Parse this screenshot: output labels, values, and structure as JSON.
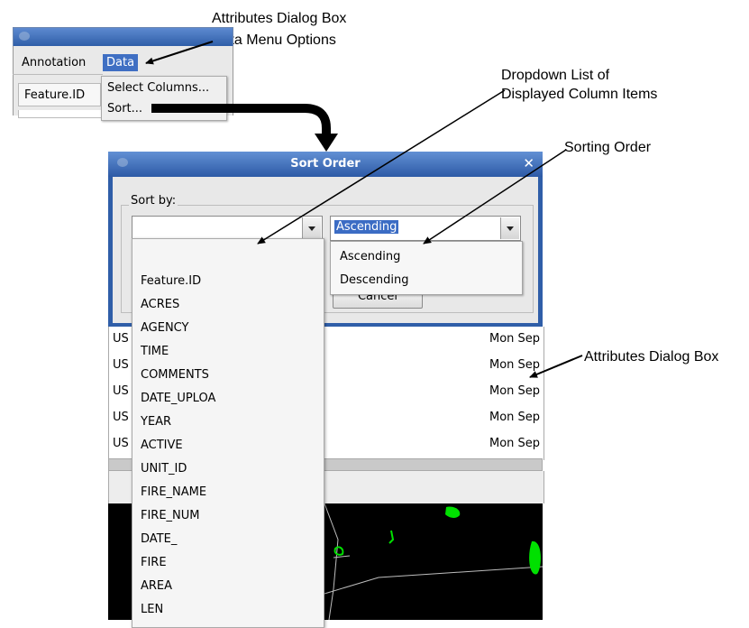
{
  "callouts": {
    "attributes_dialog_box_top": "Attributes Dialog Box",
    "data_menu_options": "Data Menu Options",
    "dropdown_list_line1": "Dropdown List of",
    "dropdown_list_line2": "Displayed Column Items",
    "sorting_order": "Sorting Order",
    "attributes_dialog_box_right": "Attributes Dialog Box"
  },
  "attributes_snippet": {
    "menubar": [
      "Annotation",
      "Data"
    ],
    "header_cell": "Feature.ID",
    "data_menu_items": [
      "Select Columns...",
      "Sort..."
    ]
  },
  "sort_dialog": {
    "title": "Sort Order",
    "sort_by_label": "Sort by:",
    "column_combo_value": "",
    "order_combo_value": "Ascending",
    "cancel_label": "Cancel",
    "order_options": [
      "Ascending",
      "Descending"
    ],
    "column_options": [
      "Feature.ID",
      "ACRES",
      "AGENCY",
      "TIME",
      "COMMENTS",
      "DATE_UPLOA",
      "YEAR",
      "ACTIVE",
      "UNIT_ID",
      "FIRE_NAME",
      "FIRE_NUM",
      "DATE_",
      "FIRE",
      "AREA",
      "LEN"
    ]
  },
  "attributes_table": {
    "left_cells": [
      "US",
      "US",
      "US",
      "US",
      "US"
    ],
    "right_cells": [
      "Mon Sep",
      "Mon Sep",
      "Mon Sep",
      "Mon Sep",
      "Mon Sep"
    ]
  },
  "colors": {
    "titlebar": "#2f5ea8",
    "selection": "#3b6cc4",
    "map_background": "#000000",
    "map_features": "#00e000"
  },
  "icons": {
    "close": "close-icon",
    "dropdown": "chevron-down-icon",
    "arrow": "arrow-icon"
  }
}
